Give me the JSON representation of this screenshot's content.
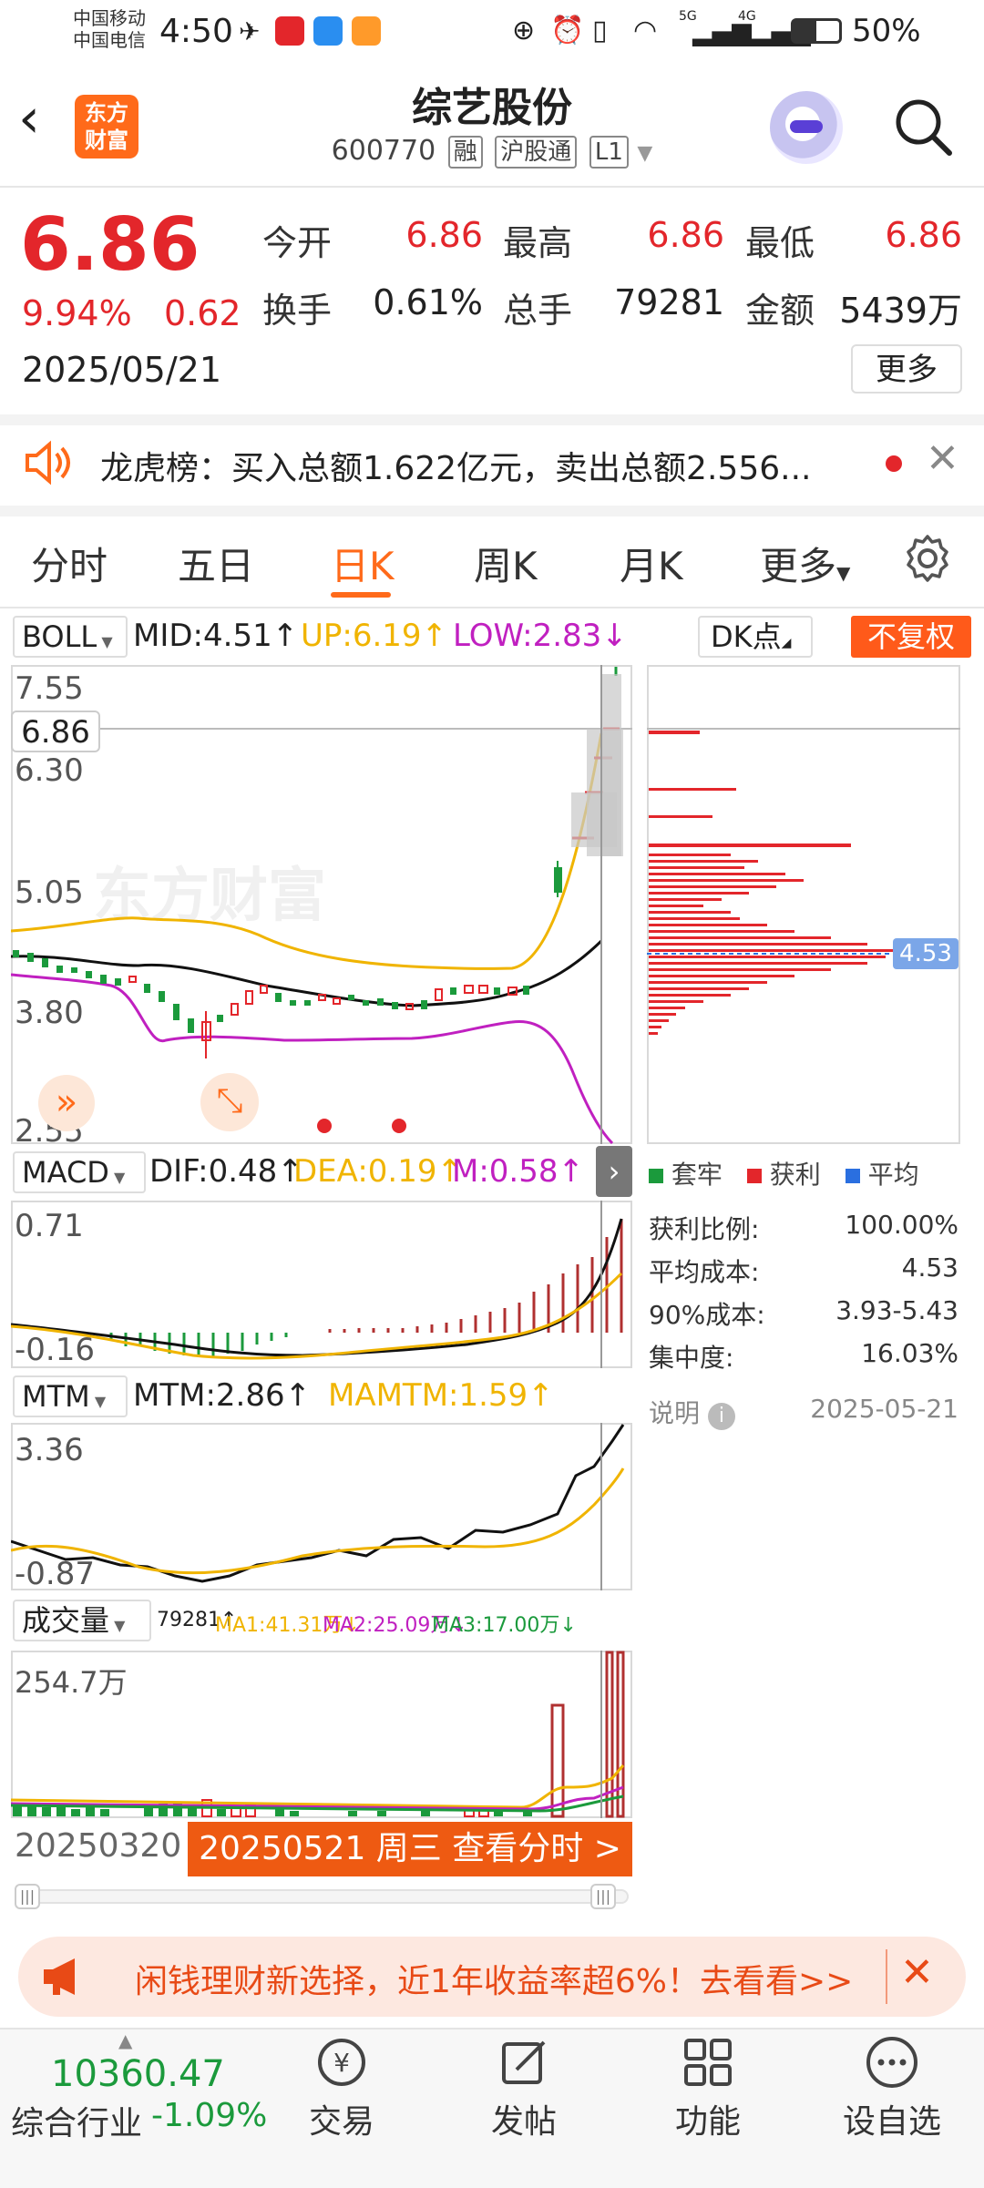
{
  "status_bar": {
    "carrier1": "中国移动",
    "carrier2": "中国电信",
    "time": "4:50",
    "battery": "50%",
    "net1": "5G",
    "net2": "4G"
  },
  "header": {
    "logo_line1": "东方",
    "logo_line2": "财富",
    "title": "综艺股份",
    "code": "600770",
    "tag1": "融",
    "tag2": "沪股通",
    "tag3": "L1"
  },
  "quote": {
    "price": "6.86",
    "change_pct": "9.94%",
    "change": "0.62",
    "date": "2025/05/21",
    "open_label": "今开",
    "open": "6.86",
    "high_label": "最高",
    "high": "6.86",
    "low_label": "最低",
    "low": "6.86",
    "turnover_label": "换手",
    "turnover": "0.61%",
    "volume_label": "总手",
    "volume": "79281",
    "amount_label": "金额",
    "amount": "5439万",
    "more_button": "更多"
  },
  "news": {
    "text": "龙虎榜：买入总额1.622亿元，卖出总额2.556..."
  },
  "tabs": [
    "分时",
    "五日",
    "日K",
    "周K",
    "月K",
    "更多"
  ],
  "active_tab_index": 2,
  "boll": {
    "selector": "BOLL",
    "mid": "MID:4.51",
    "up": "UP:6.19",
    "low": "LOW:2.83",
    "dk_selector": "DK点",
    "fq_button": "不复权",
    "axis_top": "7.55",
    "axis_current": "6.86",
    "axis_2": "6.30",
    "axis_3": "5.05",
    "axis_4": "3.80",
    "axis_bottom": "2.55"
  },
  "chip": {
    "avg_price_tag": "4.53",
    "legend_trapped": "套牢",
    "legend_profit": "获利",
    "legend_avg": "平均",
    "rows": [
      {
        "label": "获利比例:",
        "value": "100.00%"
      },
      {
        "label": "平均成本:",
        "value": "4.53"
      },
      {
        "label": "90%成本:",
        "value": "3.93-5.43"
      },
      {
        "label": "集中度:",
        "value": "16.03%"
      }
    ],
    "note_label": "说明",
    "note_date": "2025-05-21"
  },
  "macd": {
    "selector": "MACD",
    "dif": "DIF:0.48",
    "dea": "DEA:0.19",
    "m": "M:0.58",
    "axis_top": "0.71",
    "axis_bottom": "-0.16"
  },
  "mtm": {
    "selector": "MTM",
    "mtm": "MTM:2.86",
    "mamtm": "MAMTM:1.59",
    "axis_top": "3.36",
    "axis_bottom": "-0.87"
  },
  "vol": {
    "selector": "成交量",
    "value": "79281",
    "ma1": "MA1:41.31万",
    "ma2": "MA2:25.09万",
    "ma3": "MA3:17.00万",
    "axis_top": "254.7万",
    "start_date": "20250320",
    "end_banner": "20250521 周三 查看分时 >"
  },
  "ad": {
    "text": "闲钱理财新选择，近1年收益率超6%！去看看>>"
  },
  "bottom_bar": {
    "index_value": "10360.47",
    "index_name": "综合行业",
    "index_change": "-1.09%",
    "items": [
      "交易",
      "发帖",
      "功能",
      "设自选"
    ]
  },
  "colors": {
    "up": "#e3262b",
    "down": "#1b9a3c",
    "accent": "#ff6a1a",
    "boll_mid": "#222222",
    "boll_up": "#f0b400",
    "boll_low": "#c020c0"
  }
}
